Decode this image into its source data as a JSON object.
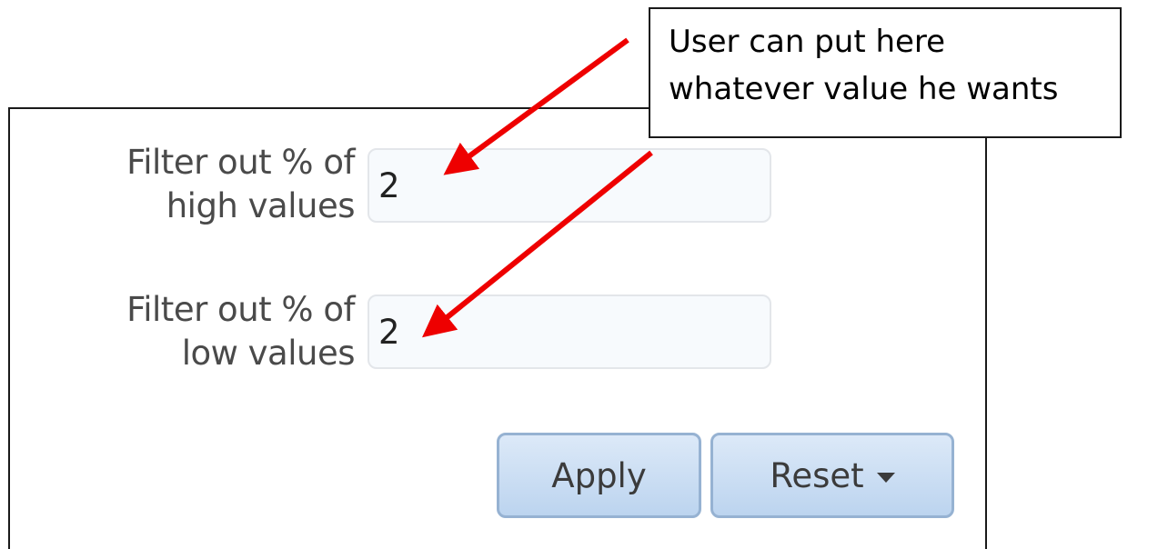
{
  "filters": {
    "high": {
      "label_line1": "Filter out % of",
      "label_line2": "high values",
      "value": "2"
    },
    "low": {
      "label_line1": "Filter out % of",
      "label_line2": "low values",
      "value": "2"
    }
  },
  "buttons": {
    "apply_label": "Apply",
    "reset_label": "Reset"
  },
  "annotation": {
    "line1": "User can put here",
    "line2": "whatever value he wants",
    "arrow_color": "#ee0000"
  },
  "icons": {
    "reset_dropdown": "caret-down-icon"
  }
}
